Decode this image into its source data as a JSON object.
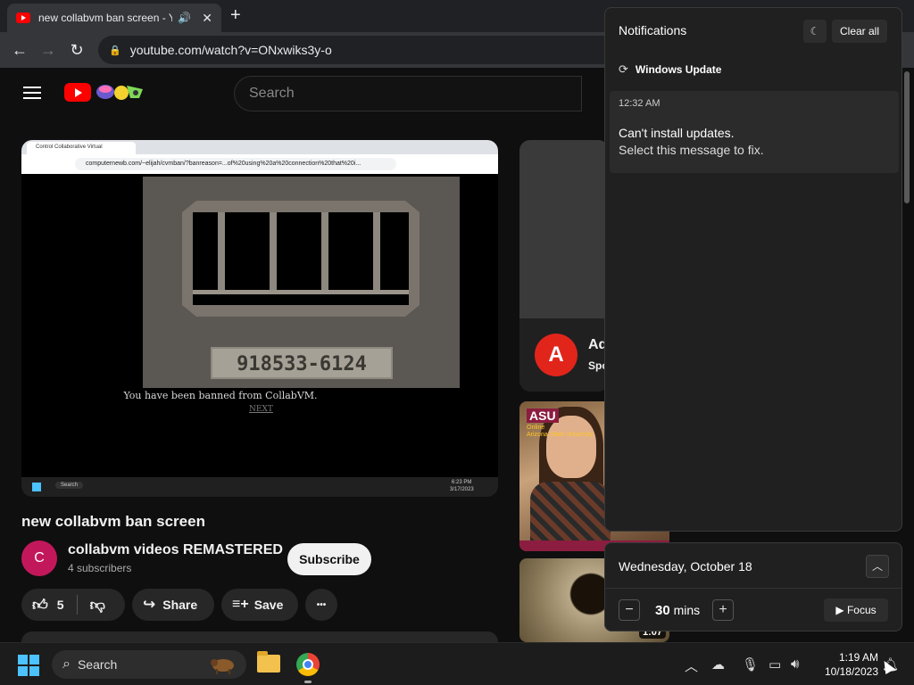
{
  "browser": {
    "tab_title": "new collabvm ban screen - Y",
    "speaker_icon": "speaker-icon",
    "new_tab_symbol": "+",
    "url": "youtube.com/watch?v=ONxwiks3y-o"
  },
  "youtube": {
    "search_placeholder": "Search",
    "video": {
      "inner_tab_title": "Control Collaborative Virtual",
      "inner_url": "computernewb.com/~elijah/cvmban/?banreason=...of%20using%20a%20connection%20that%20i...",
      "plate_text": "918533-6124",
      "banned_text": "You have been banned from CollabVM.",
      "next_text": "NEXT",
      "inner_taskbar_search": "Search",
      "inner_clock_time": "6:23 PM",
      "inner_clock_date": "3/17/2023"
    },
    "title": "new collabvm ban screen",
    "channel": {
      "avatar_letter": "C",
      "name": "collabvm videos REMASTERED",
      "subscribers": "4 subscribers",
      "subscribe_label": "Subscribe"
    },
    "actions": {
      "likes": "5",
      "share_label": "Share",
      "save_label": "Save",
      "more_label": "•••"
    },
    "sidebar": {
      "ad_title": "Ad",
      "ad_sponsored": "Spo",
      "thumb1_brand": "ASU",
      "thumb1_sub": "Online",
      "thumb1_sub2": "Arizona State University",
      "thumb2_duration": "1:07"
    }
  },
  "notifications": {
    "title": "Notifications",
    "clear_all": "Clear all",
    "group_name": "Windows Update",
    "item": {
      "time": "12:32 AM",
      "headline": "Can't install updates.",
      "body": "Select this message to fix."
    }
  },
  "calendar": {
    "date": "Wednesday, October 18",
    "focus_minutes": "30",
    "focus_unit": "mins",
    "focus_label": "Focus"
  },
  "taskbar": {
    "search_label": "Search",
    "time": "1:19 AM",
    "date": "10/18/2023"
  },
  "colors": {
    "youtube_red": "#ff0000",
    "windows_accent": "#4cc2ff",
    "subscribe_bg": "#f1f1f1"
  }
}
